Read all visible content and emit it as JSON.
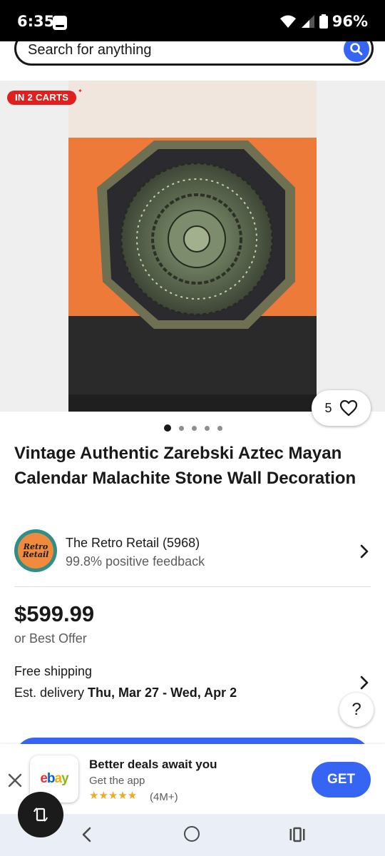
{
  "status_bar": {
    "time": "6:35",
    "battery": "96%",
    "icons": [
      "app-notification-icon",
      "wifi-icon",
      "signal-icon",
      "battery-icon"
    ]
  },
  "search": {
    "placeholder": "Search for anything",
    "icon": "search-icon"
  },
  "listing": {
    "badge": "IN 2 CARTS",
    "watch_count": "5",
    "image_count": 5,
    "active_image_index": 0,
    "title": "Vintage Authentic Zarebski Aztec Mayan Calendar Malachite Stone Wall Decoration",
    "price": "$599.99",
    "best_offer": "or Best Offer",
    "shipping": "Free shipping",
    "delivery_prefix": "Est. delivery ",
    "delivery_dates": "Thu, Mar 27 - Wed, Apr 2"
  },
  "seller": {
    "logo_line1": "Retro",
    "logo_line2": "Retail",
    "name": "The Retro Retail (5968)",
    "feedback": "99.8% positive feedback"
  },
  "help": {
    "label": "?"
  },
  "app_banner": {
    "logo_letters": [
      "e",
      "b",
      "a",
      "y"
    ],
    "title": "Better deals await you",
    "subtitle": "Get the app",
    "stars": "★★★★★",
    "rating_count": "(4M+)",
    "get_label": "GET"
  },
  "colors": {
    "accent_blue": "#3665f3",
    "badge_red": "#e0201f",
    "ebay_red": "#e53238",
    "ebay_blue": "#0064d2",
    "ebay_yellow": "#f5af02",
    "ebay_green": "#86b817"
  }
}
